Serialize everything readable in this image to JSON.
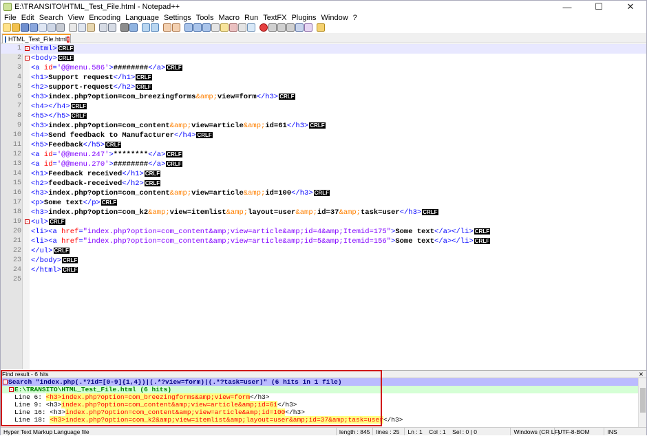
{
  "window": {
    "title": "E:\\TRANSITO\\HTML_Test_File.html - Notepad++"
  },
  "menu": [
    "File",
    "Edit",
    "Search",
    "View",
    "Encoding",
    "Language",
    "Settings",
    "Tools",
    "Macro",
    "Run",
    "TextFX",
    "Plugins",
    "Window",
    "?"
  ],
  "tab": {
    "label": "HTML_Test_File.html"
  },
  "editor": {
    "line_numbers": [
      "1",
      "2",
      "3",
      "4",
      "5",
      "6",
      "7",
      "8",
      "9",
      "10",
      "11",
      "12",
      "13",
      "14",
      "15",
      "16",
      "17",
      "18",
      "19",
      "20",
      "21",
      "22",
      "23",
      "24",
      "25"
    ],
    "eol": "CRLF"
  },
  "find": {
    "header": "Find result - 6 hits",
    "search_line": "Search \"index.php(.*?id=[0-9]{1,4})|(.*?view=form)|(.*?task=user)\" (6 hits in 1 file)",
    "file_line": "E:\\TRANSITO\\HTML_Test_File.html (6 hits)",
    "hits": [
      {
        "label": "Line 6: ",
        "text": "<h3>index.php?option=com_breezingforms&amp;view=form</h3>",
        "start": "<h3>",
        "match": "index.php?option=com_breezingforms&amp;view=form",
        "end": "</h3>"
      },
      {
        "label": "Line 9: ",
        "start": "<h3>",
        "match": "index.php?option=com_content&amp;view=article&amp;id=61",
        "end": "</h3>"
      },
      {
        "label": "Line 16: ",
        "start": "<h3>",
        "match": "index.php?option=com_content&amp;view=article&amp;id=100",
        "end": "</h3>"
      },
      {
        "label": "Line 18: ",
        "start": "<h3>",
        "match": "index.php?option=com_k2&amp;view=itemlist&amp;layout=user&amp;id=37&amp;task=user",
        "end": "</h3>"
      }
    ]
  },
  "status": {
    "language": "Hyper Text Markup Language file",
    "length": "length : 845",
    "lines": "lines : 25",
    "position": "Ln : 1    Col : 1    Sel : 0 | 0",
    "eol": "Windows (CR LF)",
    "encoding": "UTF-8-BOM",
    "mode": "INS"
  }
}
